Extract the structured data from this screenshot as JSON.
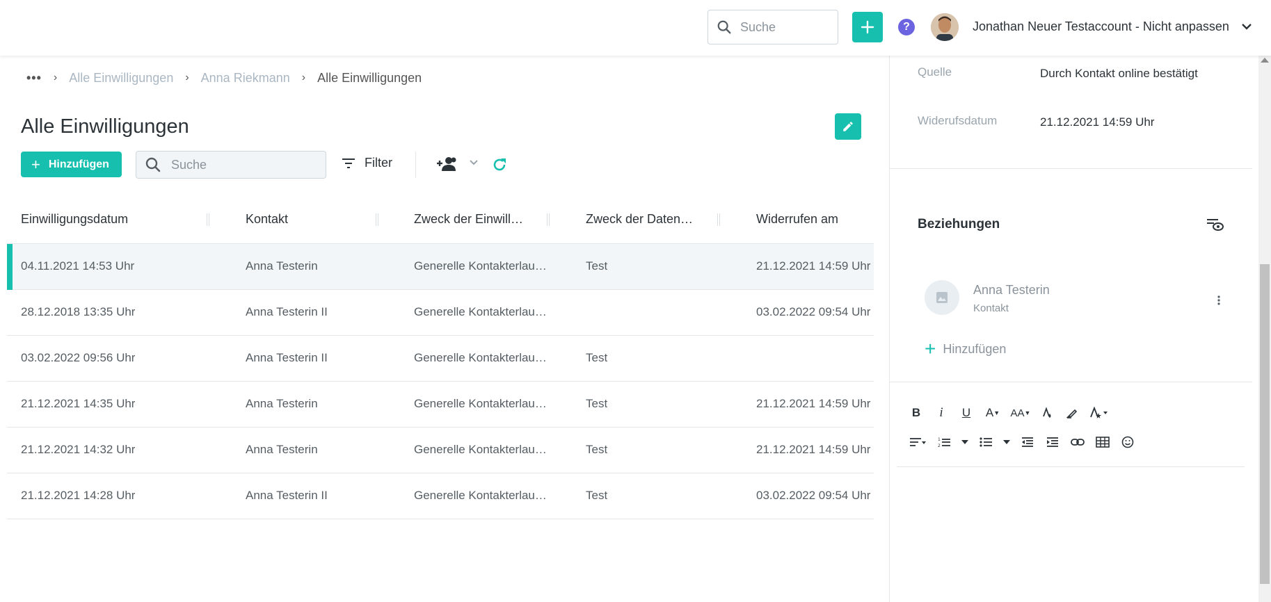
{
  "topbar": {
    "search_placeholder": "Suche",
    "help_label": "?",
    "user_name": "Jonathan Neuer Testaccount - Nicht anpassen"
  },
  "breadcrumb": {
    "dots": "•••",
    "items": [
      "Alle Einwilligungen",
      "Anna Riekmann",
      "Alle Einwilligungen"
    ]
  },
  "page": {
    "title": "Alle Einwilligungen",
    "add_label": "Hinzufügen",
    "search_placeholder": "Suche",
    "filter_label": "Filter"
  },
  "table": {
    "columns": [
      "Einwilligungsdatum",
      "Kontakt",
      "Zweck der Einwill…",
      "Zweck der Daten…",
      "Widerrufen am"
    ],
    "rows": [
      {
        "date": "04.11.2021 14:53 Uhr",
        "contact": "Anna Testerin",
        "purpose": "Generelle Kontakterlau…",
        "data_purpose": "Test",
        "revoked": "21.12.2021 14:59 Uhr"
      },
      {
        "date": "28.12.2018 13:35 Uhr",
        "contact": "Anna Testerin II",
        "purpose": "Generelle Kontakterlau…",
        "data_purpose": "",
        "revoked": "03.02.2022 09:54 Uhr"
      },
      {
        "date": "03.02.2022 09:56 Uhr",
        "contact": "Anna Testerin II",
        "purpose": "Generelle Kontakterlau…",
        "data_purpose": "Test",
        "revoked": ""
      },
      {
        "date": "21.12.2021 14:35 Uhr",
        "contact": "Anna Testerin",
        "purpose": "Generelle Kontakterlau…",
        "data_purpose": "Test",
        "revoked": "21.12.2021 14:59 Uhr"
      },
      {
        "date": "21.12.2021 14:32 Uhr",
        "contact": "Anna Testerin",
        "purpose": "Generelle Kontakterlau…",
        "data_purpose": "Test",
        "revoked": "21.12.2021 14:59 Uhr"
      },
      {
        "date": "21.12.2021 14:28 Uhr",
        "contact": "Anna Testerin II",
        "purpose": "Generelle Kontakterlau…",
        "data_purpose": "Test",
        "revoked": "03.02.2022 09:54 Uhr"
      }
    ]
  },
  "detail": {
    "source_label": "Quelle",
    "source_value": "Durch Kontakt online bestätigt",
    "revoke_label": "Widerufsdatum",
    "revoke_value": "21.12.2021 14:59 Uhr",
    "relations_title": "Beziehungen",
    "relation_name": "Anna Testerin",
    "relation_type": "Kontakt",
    "relation_add": "Hinzufügen"
  },
  "editor": {
    "bold": "B",
    "italic": "i",
    "underline": "U",
    "font_size": "A",
    "font_case": "AA"
  },
  "colors": {
    "accent": "#17bfae",
    "help": "#6c63e0"
  }
}
